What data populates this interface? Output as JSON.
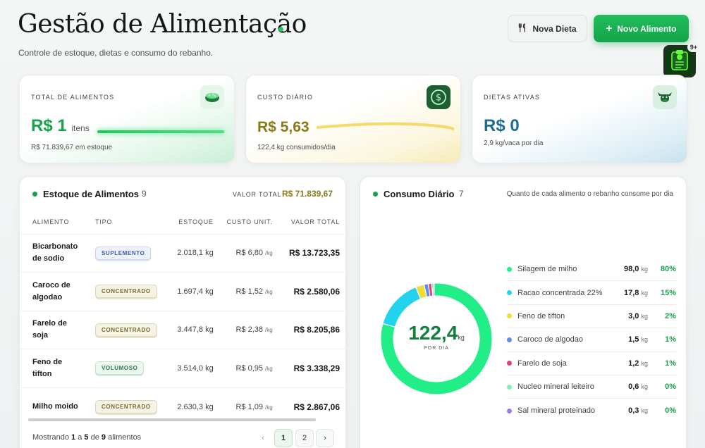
{
  "header": {
    "title": "Gestão de Alimentação",
    "subtitle": "Controle de estoque, dietas e consumo do rebanho.",
    "btn_nova_dieta": "Nova Dieta",
    "btn_novo_alimento": "Novo Alimento",
    "notification_count": "9+"
  },
  "kpis": {
    "total": {
      "label": "TOTAL DE ALIMENTOS",
      "value": "R$ 1",
      "unit": "itens",
      "foot": "R$ 71.839,67 em estoque"
    },
    "custo": {
      "label": "CUSTO DIÁRIO",
      "value": "R$ 5,63",
      "foot": "122,4 kg consumidos/dia"
    },
    "dietas": {
      "label": "DIETAS ATIVAS",
      "value": "R$ 0",
      "foot": "2,9 kg/vaca por dia"
    }
  },
  "stock_panel": {
    "title": "Estoque de Alimentos",
    "count": "9",
    "total_label": "VALOR TOTAL",
    "total_value": "R$ 71.839,67",
    "columns": [
      "ALIMENTO",
      "TIPO",
      "ESTOQUE",
      "CUSTO UNIT.",
      "VALOR TOTAL"
    ],
    "rows": [
      {
        "name": "Bicarbonato de sodio",
        "type": "SUPLEMENTO",
        "stock": "2.018,1 kg",
        "unit": "R$ 6,80",
        "unit_suffix": "/kg",
        "total": "R$ 13.723,35"
      },
      {
        "name": "Caroco de algodao",
        "type": "CONCENTRADO",
        "stock": "1.697,4 kg",
        "unit": "R$ 1,52",
        "unit_suffix": "/kg",
        "total": "R$ 2.580,06"
      },
      {
        "name": "Farelo de soja",
        "type": "CONCENTRADO",
        "stock": "3.447,8 kg",
        "unit": "R$ 2,38",
        "unit_suffix": "/kg",
        "total": "R$ 8.205,86"
      },
      {
        "name": "Feno de tifton",
        "type": "VOLUMOSO",
        "stock": "3.514,0 kg",
        "unit": "R$ 0,95",
        "unit_suffix": "/kg",
        "total": "R$ 3.338,29"
      },
      {
        "name": "Milho moido",
        "type": "CONCENTRADO",
        "stock": "2.630,3 kg",
        "unit": "R$ 1,09",
        "unit_suffix": "/kg",
        "total": "R$ 2.867,06"
      }
    ],
    "pager": {
      "prefix": "Mostrando",
      "from": "1",
      "sep1": "a",
      "to": "5",
      "sep2": "de",
      "total": "9",
      "suffix": "alimentos",
      "page1": "1",
      "page2": "2"
    }
  },
  "consumo_panel": {
    "title": "Consumo Diário",
    "count": "7",
    "hint": "Quanto de cada alimento o rebanho consome por dia",
    "center_value": "122,4",
    "center_unit": "kg",
    "center_label": "POR DIA",
    "items": [
      {
        "name": "Silagem de milho",
        "value": "98,0",
        "unit": "kg",
        "pct": "80%",
        "color": "#22ee88"
      },
      {
        "name": "Racao concentrada 22%",
        "value": "17,8",
        "unit": "kg",
        "pct": "15%",
        "color": "#22d3ee"
      },
      {
        "name": "Feno de tifton",
        "value": "3,0",
        "unit": "kg",
        "pct": "2%",
        "color": "#eedd33"
      },
      {
        "name": "Caroco de algodao",
        "value": "1,5",
        "unit": "kg",
        "pct": "1%",
        "color": "#5b8def"
      },
      {
        "name": "Farelo de soja",
        "value": "1,2",
        "unit": "kg",
        "pct": "1%",
        "color": "#e0406a"
      },
      {
        "name": "Nucleo mineral leiteiro",
        "value": "0,6",
        "unit": "kg",
        "pct": "0%",
        "color": "#7ef0b8"
      },
      {
        "name": "Sal mineral proteinado",
        "value": "0,3",
        "unit": "kg",
        "pct": "0%",
        "color": "#9b7be0"
      }
    ]
  }
}
